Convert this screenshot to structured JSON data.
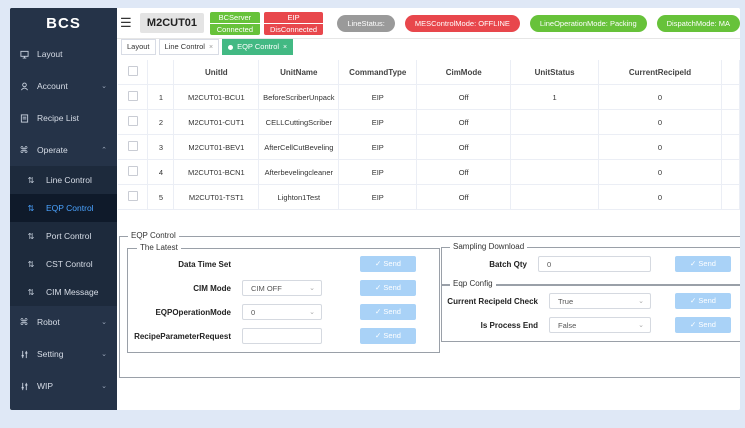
{
  "brand": "BCS",
  "sidebar": {
    "items": [
      {
        "label": "Layout",
        "icon": "monitor-icon"
      },
      {
        "label": "Account",
        "icon": "user-icon"
      },
      {
        "label": "Recipe List",
        "icon": "book-icon"
      },
      {
        "label": "Operate",
        "icon": "command-icon"
      },
      {
        "label": "Robot",
        "icon": "command-icon"
      },
      {
        "label": "Setting",
        "icon": "sliders-icon"
      },
      {
        "label": "WIP",
        "icon": "sliders-icon"
      }
    ],
    "operate_subitems": [
      {
        "label": "Line Control"
      },
      {
        "label": "EQP Control"
      },
      {
        "label": "Port Control"
      },
      {
        "label": "CST Control"
      },
      {
        "label": "CIM Message"
      }
    ]
  },
  "header": {
    "line_id": "M2CUT01",
    "bcserver_title": "BCServer",
    "bcserver_status": "Connected",
    "eip_title": "EIP",
    "eip_status": "DisConnected",
    "line_status": "LineStatus:",
    "mes_mode": "MESControlMode: OFFLINE",
    "line_op_mode": "LineOperationMode: Packing",
    "dispatch_mode": "DispatchMode: MA"
  },
  "tabs": [
    {
      "label": "Layout"
    },
    {
      "label": "Line Control"
    },
    {
      "label": "EQP Control"
    }
  ],
  "table": {
    "headers": [
      "UnitId",
      "UnitName",
      "CommandType",
      "CimMode",
      "UnitStatus",
      "CurrentRecipeId"
    ],
    "rows": [
      {
        "no": "1",
        "unitid": "M2CUT01-BCU1",
        "unitname": "BeforeScriberUnpack",
        "cmd": "EIP",
        "cim": "Off",
        "status": "1",
        "recipe": "0"
      },
      {
        "no": "2",
        "unitid": "M2CUT01-CUT1",
        "unitname": "CELLCuttingScriber",
        "cmd": "EIP",
        "cim": "Off",
        "status": "",
        "recipe": "0"
      },
      {
        "no": "3",
        "unitid": "M2CUT01-BEV1",
        "unitname": "AfterCellCutBeveling",
        "cmd": "EIP",
        "cim": "Off",
        "status": "",
        "recipe": "0"
      },
      {
        "no": "4",
        "unitid": "M2CUT01-BCN1",
        "unitname": "Afterbevelingcleaner",
        "cmd": "EIP",
        "cim": "Off",
        "status": "",
        "recipe": "0"
      },
      {
        "no": "5",
        "unitid": "M2CUT01-TST1",
        "unitname": "Lighton1Test",
        "cmd": "EIP",
        "cim": "Off",
        "status": "",
        "recipe": "0"
      }
    ]
  },
  "eqp": {
    "title": "EQP Control",
    "latest_title": "The Latest",
    "datetime_label": "Data Time Set",
    "cim_mode_label": "CIM Mode",
    "cim_mode_value": "CIM OFF",
    "eqp_op_label": "EQPOperationMode",
    "eqp_op_value": "0",
    "recipe_param_label": "RecipeParameterRequest",
    "send_label": "Send",
    "sampling_title": "Sampling Download",
    "batch_qty_label": "Batch Qty",
    "batch_qty_value": "0",
    "eqp_config_title": "Eqp Config",
    "current_recipe_check_label": "Current RecipeId Check",
    "current_recipe_check_value": "True",
    "is_process_end_label": "Is Process End",
    "is_process_end_value": "False"
  },
  "colors": {
    "sidebar_bg": "#253348",
    "active_blue": "#4aa3ff",
    "green": "#67c23a",
    "red": "#e8474c",
    "gray": "#9a9a9a",
    "tab_green": "#42b983",
    "send_blue": "#a9d2f7"
  }
}
